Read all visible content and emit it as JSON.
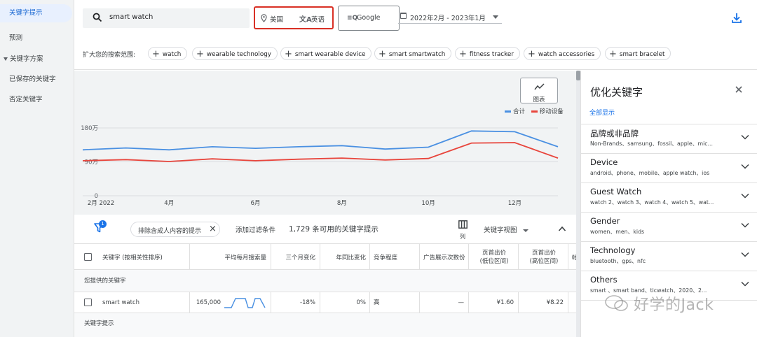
{
  "sidebar": {
    "items": [
      {
        "label": "关键字提示",
        "active": true
      },
      {
        "label": "预测"
      },
      {
        "label": "关键字方案",
        "expandable": true
      },
      {
        "label": "已保存的关键字"
      },
      {
        "label": "否定关键字"
      }
    ]
  },
  "topbar": {
    "search_value": "smart watch",
    "location": "美国",
    "language": "英语",
    "network": "Google",
    "date_range": "2022年2月 - 2023年1月",
    "expand_label": "扩大您的搜索范围:",
    "suggestion_chips": [
      "watch",
      "wearable technology",
      "smart wearable device",
      "smart smartwatch",
      "fitness tracker",
      "watch accessories",
      "smart bracelet"
    ]
  },
  "chart_data": {
    "type": "line",
    "button_label": "图表",
    "x_tick_labels": [
      "2月 2022",
      "4月",
      "6月",
      "8月",
      "10月",
      "12月"
    ],
    "y_tick_labels": [
      "180万",
      "90万",
      "0"
    ],
    "ylim": [
      0,
      1800000
    ],
    "categories": [
      "2022-02",
      "2022-03",
      "2022-04",
      "2022-05",
      "2022-06",
      "2022-07",
      "2022-08",
      "2022-09",
      "2022-10",
      "2022-11",
      "2022-12",
      "2023-01"
    ],
    "series": [
      {
        "name": "合计",
        "color": "#4a90e2",
        "values": [
          1220000,
          1270000,
          1220000,
          1300000,
          1260000,
          1300000,
          1330000,
          1240000,
          1290000,
          1720000,
          1700000,
          1300000
        ]
      },
      {
        "name": "移动设备",
        "color": "#e8453c",
        "values": [
          930000,
          960000,
          910000,
          980000,
          930000,
          970000,
          1000000,
          950000,
          990000,
          1400000,
          1410000,
          1000000
        ]
      }
    ]
  },
  "filter_bar": {
    "filter_badge": "1",
    "adult_chip": "排除含成人内容的提示",
    "add_filter": "添加过滤条件",
    "count_text": "1,729 条可用的关键字提示",
    "columns_label": "列",
    "view_label": "关键字视图"
  },
  "table": {
    "headers": {
      "keyword": "关键字 (按相关性排序)",
      "avg_searches": "平均每月搜索量",
      "three_month": "三个月变化",
      "yoy": "年同比变化",
      "competition": "竞争程度",
      "impression_share": "广告展示次数份",
      "bid_low": "页首出价\n(低位区间)",
      "bid_high": "页首出价\n(高位区间)",
      "truncated": "帐"
    },
    "group_provided": "您提供的关键字",
    "group_suggestions": "关键字提示",
    "rows": [
      {
        "keyword": "smart watch",
        "avg_searches": "165,000",
        "three_month": "-18%",
        "yoy": "0%",
        "competition": "高",
        "impression_share": "—",
        "bid_low": "¥1.60",
        "bid_high": "¥8.22"
      }
    ]
  },
  "right_panel": {
    "title": "优化关键字",
    "show_all": "全部显示",
    "facets": [
      {
        "name": "品牌或非品牌",
        "sub": "Non-Brands、samsung、fossil、apple、mic..."
      },
      {
        "name": "Device",
        "sub": "android、phone、mobile、apple watch、ios"
      },
      {
        "name": "Guest Watch",
        "sub": "watch 2、watch 3、watch 4、watch 5、wat..."
      },
      {
        "name": "Gender",
        "sub": "women、men、kids"
      },
      {
        "name": "Technology",
        "sub": "bluetooth、gps、nfc"
      },
      {
        "name": "Others",
        "sub": "smart 、smart band、ticwatch、2020、2..."
      }
    ]
  },
  "watermark": "好学的Jack"
}
